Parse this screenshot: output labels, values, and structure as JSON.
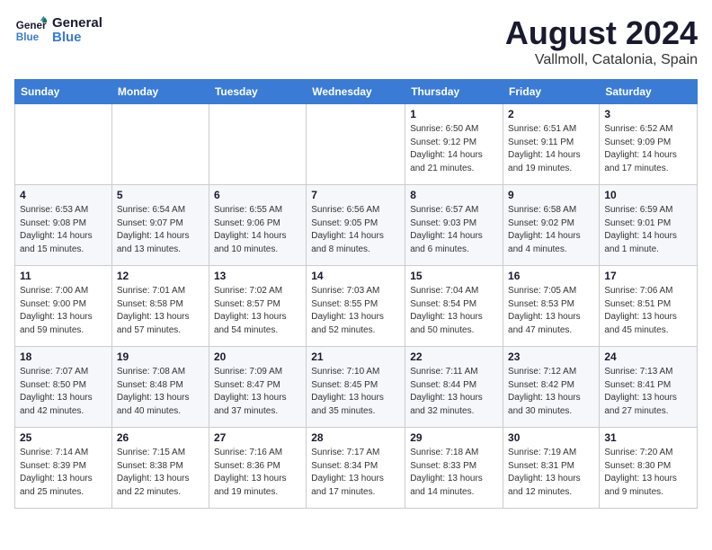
{
  "header": {
    "logo_line1": "General",
    "logo_line2": "Blue",
    "month_title": "August 2024",
    "location": "Vallmoll, Catalonia, Spain"
  },
  "days_of_week": [
    "Sunday",
    "Monday",
    "Tuesday",
    "Wednesday",
    "Thursday",
    "Friday",
    "Saturday"
  ],
  "weeks": [
    [
      {
        "day": "",
        "info": ""
      },
      {
        "day": "",
        "info": ""
      },
      {
        "day": "",
        "info": ""
      },
      {
        "day": "",
        "info": ""
      },
      {
        "day": "1",
        "info": "Sunrise: 6:50 AM\nSunset: 9:12 PM\nDaylight: 14 hours\nand 21 minutes."
      },
      {
        "day": "2",
        "info": "Sunrise: 6:51 AM\nSunset: 9:11 PM\nDaylight: 14 hours\nand 19 minutes."
      },
      {
        "day": "3",
        "info": "Sunrise: 6:52 AM\nSunset: 9:09 PM\nDaylight: 14 hours\nand 17 minutes."
      }
    ],
    [
      {
        "day": "4",
        "info": "Sunrise: 6:53 AM\nSunset: 9:08 PM\nDaylight: 14 hours\nand 15 minutes."
      },
      {
        "day": "5",
        "info": "Sunrise: 6:54 AM\nSunset: 9:07 PM\nDaylight: 14 hours\nand 13 minutes."
      },
      {
        "day": "6",
        "info": "Sunrise: 6:55 AM\nSunset: 9:06 PM\nDaylight: 14 hours\nand 10 minutes."
      },
      {
        "day": "7",
        "info": "Sunrise: 6:56 AM\nSunset: 9:05 PM\nDaylight: 14 hours\nand 8 minutes."
      },
      {
        "day": "8",
        "info": "Sunrise: 6:57 AM\nSunset: 9:03 PM\nDaylight: 14 hours\nand 6 minutes."
      },
      {
        "day": "9",
        "info": "Sunrise: 6:58 AM\nSunset: 9:02 PM\nDaylight: 14 hours\nand 4 minutes."
      },
      {
        "day": "10",
        "info": "Sunrise: 6:59 AM\nSunset: 9:01 PM\nDaylight: 14 hours\nand 1 minute."
      }
    ],
    [
      {
        "day": "11",
        "info": "Sunrise: 7:00 AM\nSunset: 9:00 PM\nDaylight: 13 hours\nand 59 minutes."
      },
      {
        "day": "12",
        "info": "Sunrise: 7:01 AM\nSunset: 8:58 PM\nDaylight: 13 hours\nand 57 minutes."
      },
      {
        "day": "13",
        "info": "Sunrise: 7:02 AM\nSunset: 8:57 PM\nDaylight: 13 hours\nand 54 minutes."
      },
      {
        "day": "14",
        "info": "Sunrise: 7:03 AM\nSunset: 8:55 PM\nDaylight: 13 hours\nand 52 minutes."
      },
      {
        "day": "15",
        "info": "Sunrise: 7:04 AM\nSunset: 8:54 PM\nDaylight: 13 hours\nand 50 minutes."
      },
      {
        "day": "16",
        "info": "Sunrise: 7:05 AM\nSunset: 8:53 PM\nDaylight: 13 hours\nand 47 minutes."
      },
      {
        "day": "17",
        "info": "Sunrise: 7:06 AM\nSunset: 8:51 PM\nDaylight: 13 hours\nand 45 minutes."
      }
    ],
    [
      {
        "day": "18",
        "info": "Sunrise: 7:07 AM\nSunset: 8:50 PM\nDaylight: 13 hours\nand 42 minutes."
      },
      {
        "day": "19",
        "info": "Sunrise: 7:08 AM\nSunset: 8:48 PM\nDaylight: 13 hours\nand 40 minutes."
      },
      {
        "day": "20",
        "info": "Sunrise: 7:09 AM\nSunset: 8:47 PM\nDaylight: 13 hours\nand 37 minutes."
      },
      {
        "day": "21",
        "info": "Sunrise: 7:10 AM\nSunset: 8:45 PM\nDaylight: 13 hours\nand 35 minutes."
      },
      {
        "day": "22",
        "info": "Sunrise: 7:11 AM\nSunset: 8:44 PM\nDaylight: 13 hours\nand 32 minutes."
      },
      {
        "day": "23",
        "info": "Sunrise: 7:12 AM\nSunset: 8:42 PM\nDaylight: 13 hours\nand 30 minutes."
      },
      {
        "day": "24",
        "info": "Sunrise: 7:13 AM\nSunset: 8:41 PM\nDaylight: 13 hours\nand 27 minutes."
      }
    ],
    [
      {
        "day": "25",
        "info": "Sunrise: 7:14 AM\nSunset: 8:39 PM\nDaylight: 13 hours\nand 25 minutes."
      },
      {
        "day": "26",
        "info": "Sunrise: 7:15 AM\nSunset: 8:38 PM\nDaylight: 13 hours\nand 22 minutes."
      },
      {
        "day": "27",
        "info": "Sunrise: 7:16 AM\nSunset: 8:36 PM\nDaylight: 13 hours\nand 19 minutes."
      },
      {
        "day": "28",
        "info": "Sunrise: 7:17 AM\nSunset: 8:34 PM\nDaylight: 13 hours\nand 17 minutes."
      },
      {
        "day": "29",
        "info": "Sunrise: 7:18 AM\nSunset: 8:33 PM\nDaylight: 13 hours\nand 14 minutes."
      },
      {
        "day": "30",
        "info": "Sunrise: 7:19 AM\nSunset: 8:31 PM\nDaylight: 13 hours\nand 12 minutes."
      },
      {
        "day": "31",
        "info": "Sunrise: 7:20 AM\nSunset: 8:30 PM\nDaylight: 13 hours\nand 9 minutes."
      }
    ]
  ]
}
